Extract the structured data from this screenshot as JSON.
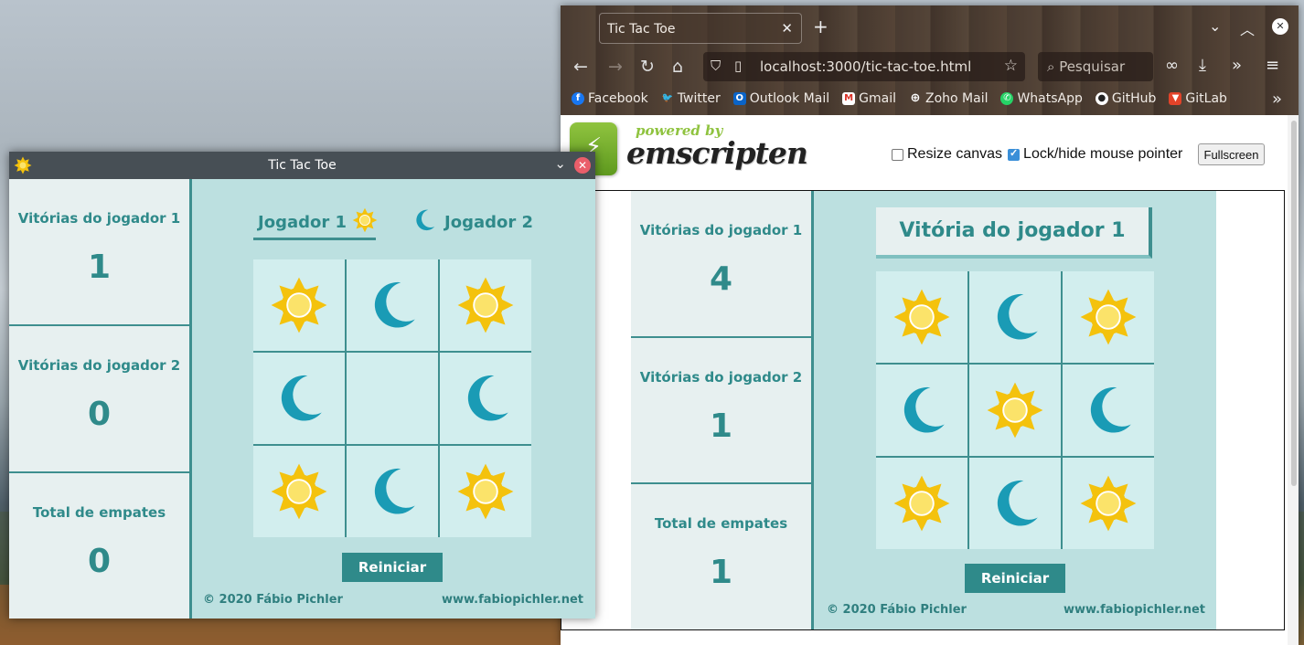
{
  "colors": {
    "teal": "#2f8a8a",
    "panel": "#bce0e0",
    "cell": "#d2eeee",
    "sun": "#f4c20d",
    "moon": "#1a9bb5"
  },
  "firefox": {
    "tab_title": "Tic Tac Toe",
    "url": "localhost:3000/tic-tac-toe.html",
    "search_placeholder": "Pesquisar",
    "bookmarks": [
      "Facebook",
      "Twitter",
      "Outlook Mail",
      "Gmail",
      "Zoho Mail",
      "WhatsApp",
      "GitHub",
      "GitLab"
    ],
    "emscripten": {
      "powered_by": "powered by",
      "name": "emscripten",
      "resize_canvas": "Resize canvas",
      "lock_pointer": "Lock/hide mouse pointer",
      "fullscreen": "Fullscreen"
    }
  },
  "kde_window": {
    "title": "Tic Tac Toe"
  },
  "game_left": {
    "stats": [
      {
        "label": "Vitórias do jogador 1",
        "value": "1"
      },
      {
        "label": "Vitórias do jogador 2",
        "value": "0"
      },
      {
        "label": "Total de empates",
        "value": "0"
      }
    ],
    "player1": "Jogador 1",
    "player2": "Jogador 2",
    "board": [
      "sun",
      "moon",
      "sun",
      "moon",
      "",
      "moon",
      "sun",
      "moon",
      "sun"
    ],
    "reset": "Reiniciar",
    "copyright": "© 2020 Fábio Pichler",
    "website": "www.fabiopichler.net"
  },
  "game_right": {
    "stats": [
      {
        "label": "Vitórias do jogador 1",
        "value": "4"
      },
      {
        "label": "Vitórias do jogador 2",
        "value": "1"
      },
      {
        "label": "Total de empates",
        "value": "1"
      }
    ],
    "status": "Vitória do jogador 1",
    "board": [
      "sun",
      "moon",
      "sun",
      "moon",
      "sun",
      "moon",
      "sun",
      "moon",
      "sun"
    ],
    "reset": "Reiniciar",
    "copyright": "© 2020 Fábio Pichler",
    "website": "www.fabiopichler.net"
  }
}
